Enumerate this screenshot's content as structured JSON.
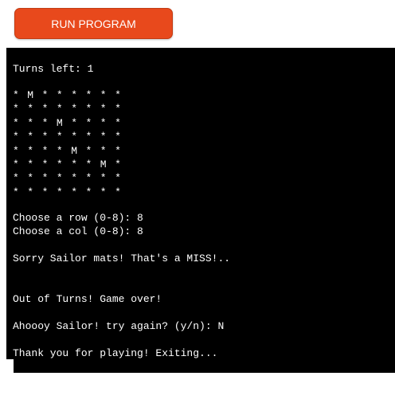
{
  "toolbar": {
    "run_label": "RUN PROGRAM"
  },
  "terminal": {
    "turns_left": "Turns left: 1",
    "board": [
      [
        "*",
        "M",
        "*",
        "*",
        "*",
        "*",
        "*",
        "*"
      ],
      [
        "*",
        "*",
        "*",
        "*",
        "*",
        "*",
        "*",
        "*"
      ],
      [
        "*",
        "*",
        "*",
        "M",
        "*",
        "*",
        "*",
        "*"
      ],
      [
        "*",
        "*",
        "*",
        "*",
        "*",
        "*",
        "*",
        "*"
      ],
      [
        "*",
        "*",
        "*",
        "*",
        "M",
        "*",
        "*",
        "*"
      ],
      [
        "*",
        "*",
        "*",
        "*",
        "*",
        "*",
        "M",
        "*"
      ],
      [
        "*",
        "*",
        "*",
        "*",
        "*",
        "*",
        "*",
        "*"
      ],
      [
        "*",
        "*",
        "*",
        "*",
        "*",
        "*",
        "*",
        "*"
      ]
    ],
    "row_prompt": "Choose a row (0-8): 8",
    "col_prompt": "Choose a col (0-8): 8",
    "miss_message": "Sorry Sailor mats! That's a MISS!..",
    "game_over": "Out of Turns! Game over!",
    "try_again": "Ahoooy Sailor! try again? (y/n): N",
    "exit_message": "Thank you for playing! Exiting..."
  },
  "colors": {
    "button": "#e8491c",
    "terminal_background": "#000000",
    "terminal_text": "#ffffff"
  }
}
